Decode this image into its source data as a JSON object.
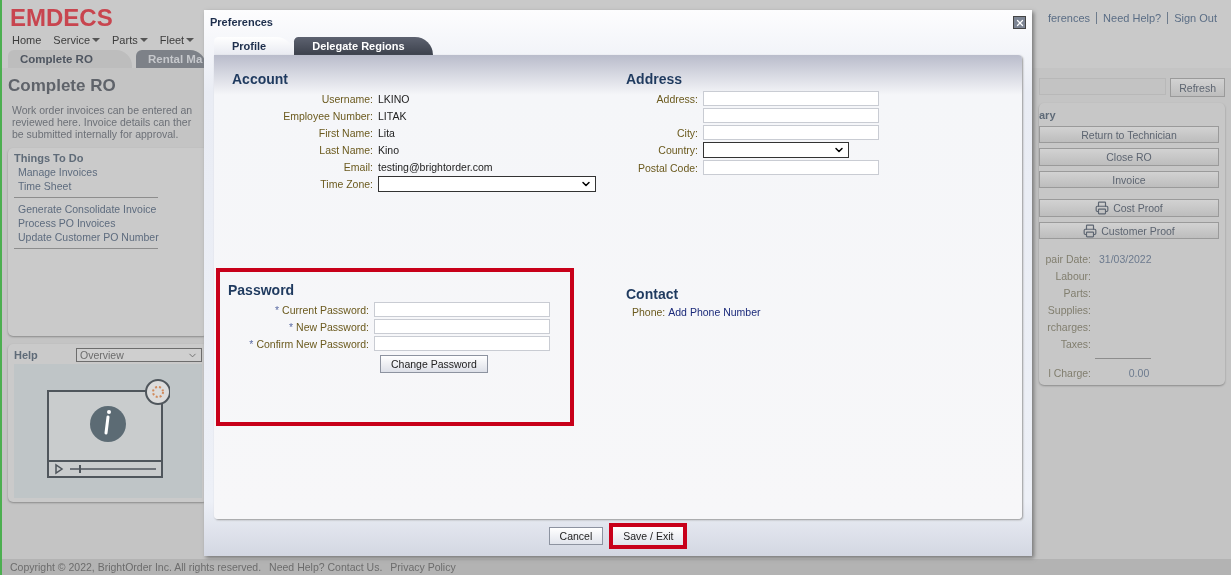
{
  "app": {
    "logo": "EMDECS",
    "nav": [
      {
        "label": "Home",
        "has_menu": false
      },
      {
        "label": "Service",
        "has_menu": true
      },
      {
        "label": "Parts",
        "has_menu": true
      },
      {
        "label": "Fleet",
        "has_menu": true
      }
    ],
    "top_links": [
      "ferences",
      "Need Help?",
      "Sign Out"
    ]
  },
  "page_tabs": [
    {
      "label": "Complete RO",
      "selected": true
    },
    {
      "label": "Rental Ma",
      "selected": false
    }
  ],
  "page_title": "Complete RO",
  "intro": [
    "Work order invoices can be entered an",
    "reviewed here. Invoice details can ther",
    "be submitted internally for approval."
  ],
  "things_to_do": {
    "title": "Things To Do",
    "groups": [
      [
        "Manage Invoices",
        "Time Sheet"
      ],
      [
        "Generate Consolidate Invoice",
        "Process PO Invoices",
        "Update Customer PO Number"
      ]
    ]
  },
  "help": {
    "title": "Help",
    "select": "Overview"
  },
  "refresh_button": "Refresh",
  "summary": {
    "title": "ary",
    "buttons": [
      {
        "label": "Return to Technician",
        "kind": "plain"
      },
      {
        "label": "Close RO",
        "kind": "plain"
      },
      {
        "label": "Invoice",
        "kind": "plain"
      },
      {
        "label": "Cost Proof",
        "kind": "print"
      },
      {
        "label": "Customer Proof",
        "kind": "print"
      }
    ],
    "rows": [
      {
        "label": "pair Date:",
        "value": "31/03/2022"
      },
      {
        "label": "Labour:"
      },
      {
        "label": "Parts:"
      },
      {
        "label": "Supplies:"
      },
      {
        "label": "rcharges:"
      },
      {
        "label": "Taxes:"
      }
    ],
    "total": {
      "label": "l Charge:",
      "value": "0.00"
    }
  },
  "footer": [
    "Copyright © 2022, BrightOrder Inc. All rights reserved.",
    "Need Help? Contact Us.",
    "Privacy Policy"
  ],
  "dialog": {
    "title": "Preferences",
    "tabs": [
      {
        "label": "Profile",
        "selected": true
      },
      {
        "label": "Delegate Regions",
        "selected": false
      }
    ],
    "account": {
      "title": "Account",
      "fields": [
        {
          "label": "Username:",
          "kind": "text",
          "value": "LKINO"
        },
        {
          "label": "Employee Number:",
          "kind": "text",
          "value": "LITAK"
        },
        {
          "label": "First Name:",
          "kind": "text",
          "value": "Lita"
        },
        {
          "label": "Last Name:",
          "kind": "text",
          "value": "Kino"
        },
        {
          "label": "Email:",
          "kind": "text",
          "value": "testing@brightorder.com"
        },
        {
          "label": "Time Zone:",
          "kind": "select"
        }
      ]
    },
    "address": {
      "title": "Address",
      "fields": [
        {
          "label": "Address:",
          "kind": "input"
        },
        {
          "kind": "input"
        },
        {
          "label": "City:",
          "kind": "input"
        },
        {
          "label": "Country:",
          "kind": "select"
        },
        {
          "label": "Postal Code:",
          "kind": "input"
        }
      ]
    },
    "password": {
      "title": "Password",
      "highlighted": true,
      "required_mark": "*",
      "fields": [
        {
          "label": "Current Password:",
          "required": true
        },
        {
          "label": "New Password:",
          "required": true
        },
        {
          "label": "Confirm New Password:",
          "required": true
        }
      ],
      "button": "Change Password"
    },
    "contact": {
      "title": "Contact",
      "label": "Phone:",
      "link": "Add Phone Number"
    },
    "buttons": [
      {
        "label": "Cancel",
        "highlighted": false
      },
      {
        "label": "Save / Exit",
        "highlighted": true
      }
    ]
  }
}
